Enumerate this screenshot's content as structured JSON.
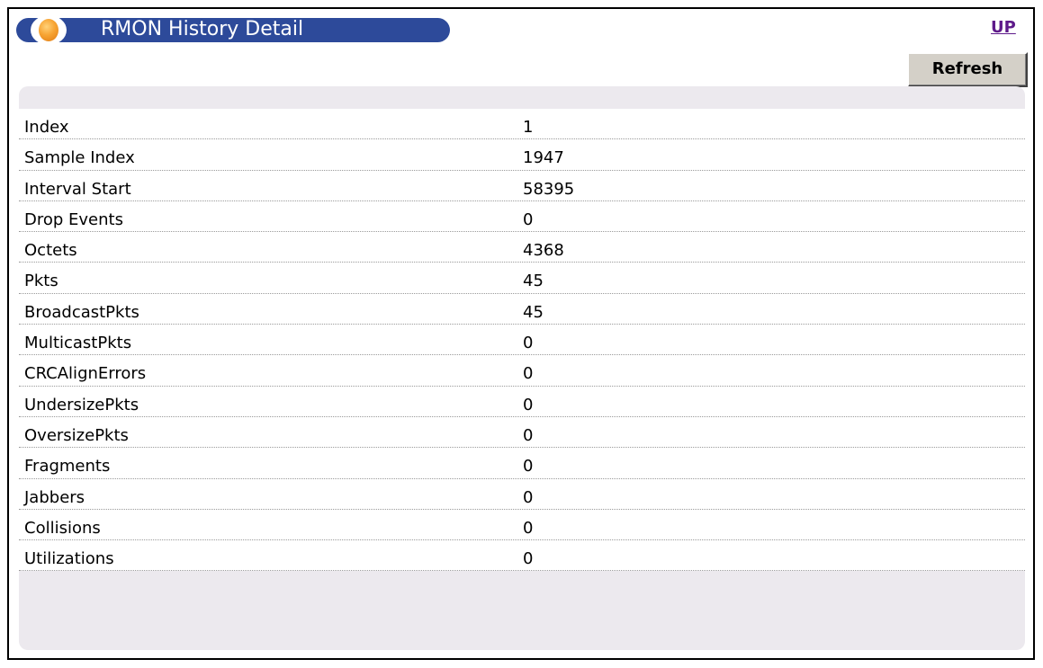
{
  "header": {
    "title": "RMON History Detail",
    "up_link": "UP",
    "refresh_label": "Refresh"
  },
  "colors": {
    "title_bar": "#2d4a9a",
    "up_link": "#5e1a8a",
    "panel_bg": "#ece9ee",
    "button_bg": "#d4d0c8"
  },
  "rows": [
    {
      "label": "Index",
      "value": "1"
    },
    {
      "label": "Sample Index",
      "value": "1947"
    },
    {
      "label": "Interval Start",
      "value": "58395"
    },
    {
      "label": "Drop Events",
      "value": "0"
    },
    {
      "label": "Octets",
      "value": "4368"
    },
    {
      "label": "Pkts",
      "value": "45"
    },
    {
      "label": "BroadcastPkts",
      "value": "45"
    },
    {
      "label": "MulticastPkts",
      "value": "0"
    },
    {
      "label": "CRCAlignErrors",
      "value": "0"
    },
    {
      "label": "UndersizePkts",
      "value": "0"
    },
    {
      "label": "OversizePkts",
      "value": "0"
    },
    {
      "label": "Fragments",
      "value": "0"
    },
    {
      "label": "Jabbers",
      "value": "0"
    },
    {
      "label": "Collisions",
      "value": "0"
    },
    {
      "label": "Utilizations",
      "value": "0"
    }
  ]
}
